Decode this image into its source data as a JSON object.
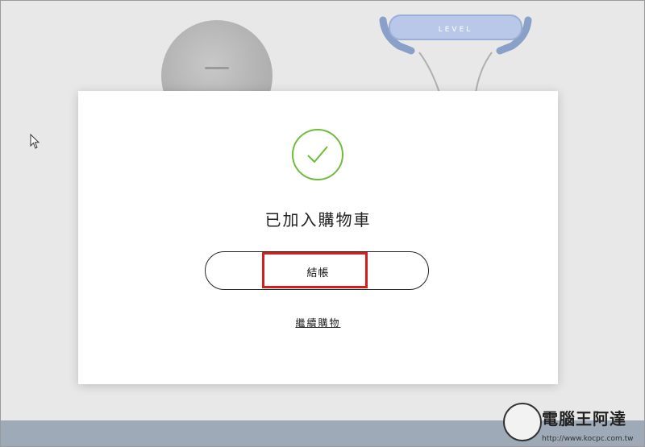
{
  "modal": {
    "title": "已加入購物車",
    "checkout_label": "結帳",
    "continue_label": "繼續購物"
  },
  "colors": {
    "success": "#6ebd3a",
    "highlight": "#d21e1e"
  },
  "background": {
    "product_right_brand": "LEVEL"
  },
  "watermark": {
    "title": "電腦王阿達",
    "url": "http://www.kocpc.com.tw"
  },
  "icons": {
    "success": "check-circle-icon",
    "pointer": "mouse-pointer-icon"
  }
}
